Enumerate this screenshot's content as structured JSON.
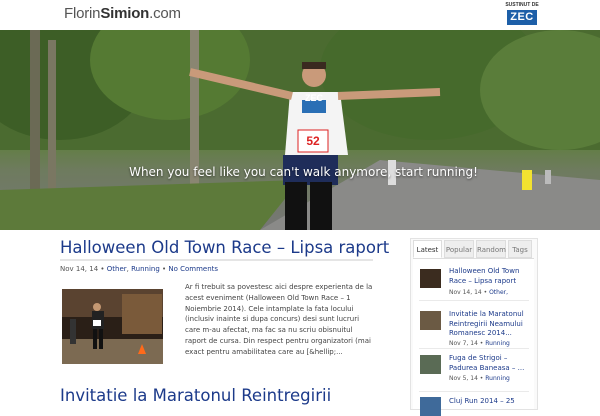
{
  "header": {
    "logo_part1": "Florin",
    "logo_part2": "Simion",
    "logo_part3": ".com",
    "sponsor_text": "SUSTINUT DE",
    "sponsor_badge": "ZEC"
  },
  "hero": {
    "tagline": "When you feel like you can't walk anymore, start running!",
    "shirt_logo": "ZEC",
    "bib_number": "52"
  },
  "posts": [
    {
      "title": "Halloween Old Town Race – Lipsa raport",
      "date": "Nov 14, 14",
      "categories": [
        "Other",
        "Running"
      ],
      "comments": "No Comments",
      "excerpt": "Ar fi trebuit sa povestesc aici despre experienta de la acest eveniment (Halloween Old Town Race – 1 Noiembrie 2014). Cele intamplate la fata locului (inclusiv inainte si dupa concurs) desi sunt lucruri care m-au afectat, ma fac sa nu scriu obisnuitul raport de cursa. Din respect pentru organizatori (mai exact pentru amabilitatea care au [&hellip;..."
    },
    {
      "title": "Invitatie la Maratonul Reintregirii"
    }
  ],
  "sidebar": {
    "tabs": [
      "Latest",
      "Popular",
      "Random",
      "Tags"
    ],
    "active_tab": "Latest",
    "items": [
      {
        "title": "Halloween Old Town Race – Lipsa raport",
        "date": "Nov 14, 14",
        "cats": "Other,"
      },
      {
        "title": "Invitatie la Maratonul Reintregirii Neamului Romanesc 2014...",
        "date": "Nov 7, 14",
        "cats": "Running"
      },
      {
        "title": "Fuga de Strigoi – Padurea Baneasa – ...",
        "date": "Nov 5, 14",
        "cats": "Running"
      },
      {
        "title": "Cluj Run 2014 – 25"
      }
    ]
  },
  "colors": {
    "link": "#1c3a8a",
    "sponsor": "#1d5fa8"
  }
}
